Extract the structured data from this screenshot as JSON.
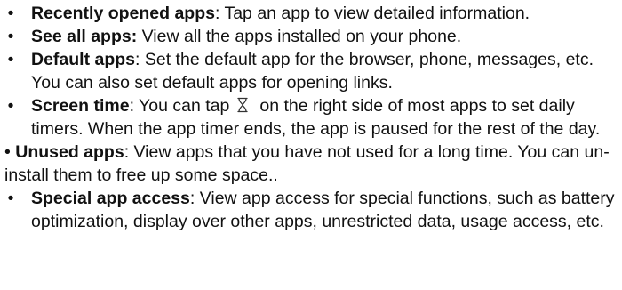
{
  "items": [
    {
      "bullet": "•",
      "term": "Recently opened apps",
      "sep": ":",
      "text": " Tap an app to view detailed information."
    },
    {
      "bullet": "•",
      "term": "See all apps:",
      "sep": "",
      "text": " View all the apps installed on your phone."
    },
    {
      "bullet": "•",
      "term": "Default apps",
      "sep": ":",
      "text": " Set the default app for the browser, phone, messages, etc. You can also set default apps for opening links."
    },
    {
      "bullet": "•",
      "term": "Screen time",
      "sep": ":",
      "text_before_icon": " You can tap",
      "icon": "hourglass-icon",
      "text_after_icon": "on the right side of most apps to set daily timers. When the app timer ends, the app is paused for the rest of the day."
    },
    {
      "bullet": "•",
      "term": "Unused apps",
      "sep": ":",
      "text": " View apps that you have not used for a long time. You can un-install them to free up some space.."
    },
    {
      "bullet": "•",
      "term": "Special app access",
      "sep": ":",
      "text": " View app access for special functions, such as battery optimization, display over other apps, unrestricted data, usage access, etc."
    }
  ]
}
